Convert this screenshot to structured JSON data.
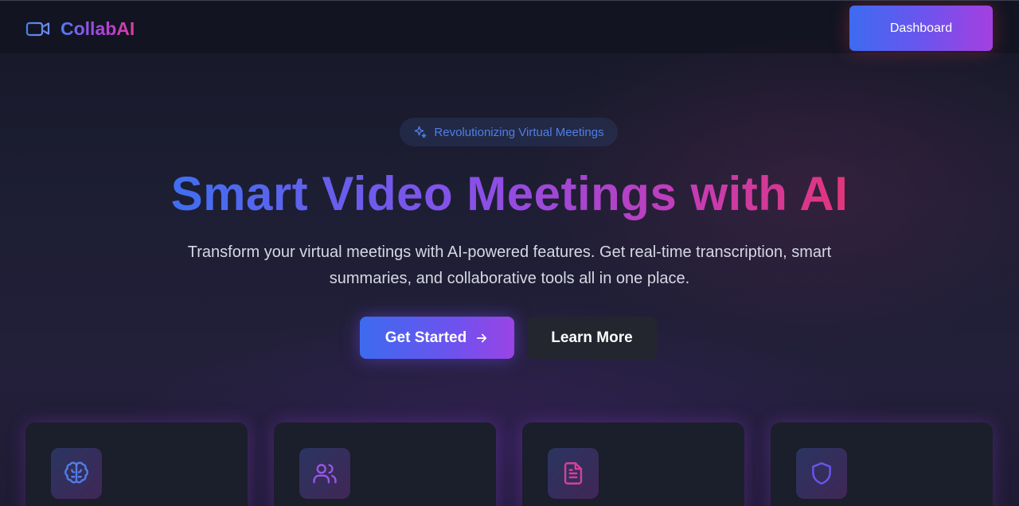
{
  "header": {
    "brand": "CollabAI",
    "dashboard_label": "Dashboard"
  },
  "hero": {
    "badge": "Revolutionizing Virtual Meetings",
    "title": "Smart Video Meetings with AI",
    "subtitle": "Transform your virtual meetings with AI-powered features. Get real-time transcription, smart summaries, and collaborative tools all in one place.",
    "primary_cta": "Get Started",
    "secondary_cta": "Learn More"
  },
  "features": [
    {
      "icon": "brain-icon",
      "color": "#4f7ee8"
    },
    {
      "icon": "users-icon",
      "color": "#9a55e6"
    },
    {
      "icon": "document-icon",
      "color": "#d93f9a"
    },
    {
      "icon": "shield-icon",
      "color": "#6a55ee"
    }
  ],
  "colors": {
    "accent_blue": "#3d6bf0",
    "accent_purple": "#a53fe0",
    "accent_pink": "#e2357a",
    "background": "#1a1c2c"
  }
}
